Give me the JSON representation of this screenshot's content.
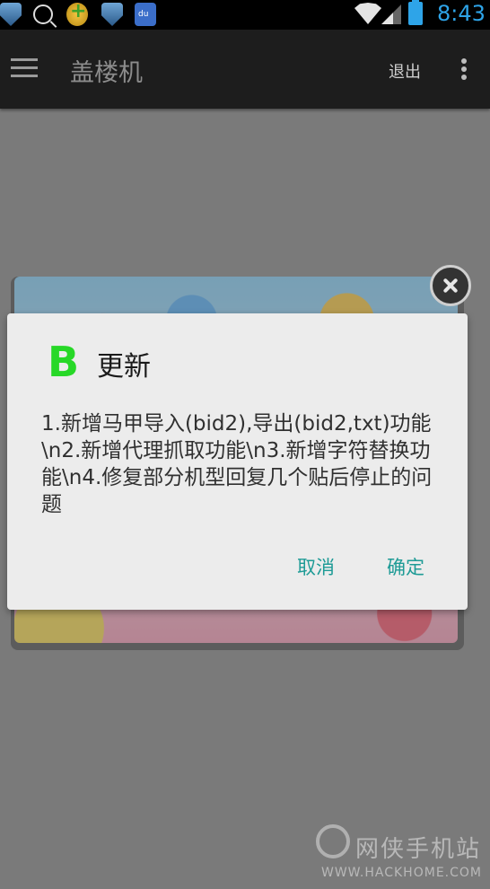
{
  "status_bar": {
    "time": "8:43",
    "icons": [
      "shield-icon",
      "search-icon",
      "plus-badge-icon",
      "shield-icon",
      "baidu-paw-icon",
      "wifi-icon",
      "signal-icon",
      "battery-icon"
    ]
  },
  "action_bar": {
    "title": "盖楼机",
    "logout_label": "退出",
    "menu_icon": "hamburger-menu-icon",
    "overflow_icon": "overflow-menu-icon"
  },
  "dialog": {
    "icon_letter": "B",
    "title": "更新",
    "message": "1.新增马甲导入(bid2),导出(bid2,txt)功能\\n2.新增代理抓取功能\\n3.新增字符替换功能\\n4.修复部分机型回复几个贴后停止的问题",
    "cancel_label": "取消",
    "confirm_label": "确定"
  },
  "watermark": {
    "name": "网侠手机站",
    "url": "WWW.HACKHOME.COM"
  },
  "colors": {
    "accent": "#1e9b96",
    "status_time": "#2ea4e8",
    "action_bar": "#1d1d1d",
    "dialog_icon": "#27d827"
  }
}
